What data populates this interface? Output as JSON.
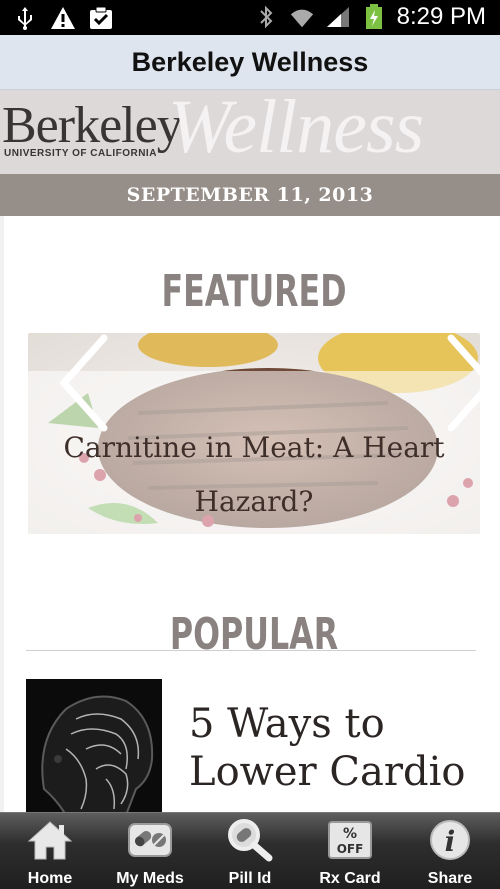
{
  "status_bar": {
    "time": "8:29 PM",
    "icons": [
      "usb-icon",
      "warning-icon",
      "clipboard-check-icon",
      "bluetooth-icon",
      "wifi-icon",
      "signal-icon",
      "battery-charging-icon"
    ]
  },
  "title_bar": {
    "title": "Berkeley Wellness"
  },
  "logo": {
    "berkeley": "Berkeley",
    "university": "UNIVERSITY OF CALIFORNIA",
    "wellness": "Wellness"
  },
  "date": "SEPTEMBER 11, 2013",
  "featured": {
    "heading": "FEATURED",
    "slide_title": "Carnitine in Meat: A Heart Hazard?",
    "prev_icon": "chevron-left-icon",
    "next_icon": "chevron-right-icon"
  },
  "popular": {
    "heading": "POPULAR",
    "items": [
      {
        "title": "5 Ways to Lower Cardio",
        "thumb_icon": "brain-scan-image"
      }
    ]
  },
  "bottom_nav": [
    {
      "label": "Home",
      "icon": "home-icon"
    },
    {
      "label": "My Meds",
      "icon": "pills-icon"
    },
    {
      "label": "Pill Id",
      "icon": "magnifier-pill-icon"
    },
    {
      "label": "Rx Card",
      "icon": "percent-off-icon",
      "icon_text": "% OFF"
    },
    {
      "label": "Share",
      "icon": "info-icon",
      "icon_text": "i"
    }
  ],
  "colors": {
    "title_bar_bg": "#dfe5ee",
    "date_bar_bg": "#968e88",
    "heading_text": "#8a8280",
    "nav_bg": "#2e2e2e"
  }
}
